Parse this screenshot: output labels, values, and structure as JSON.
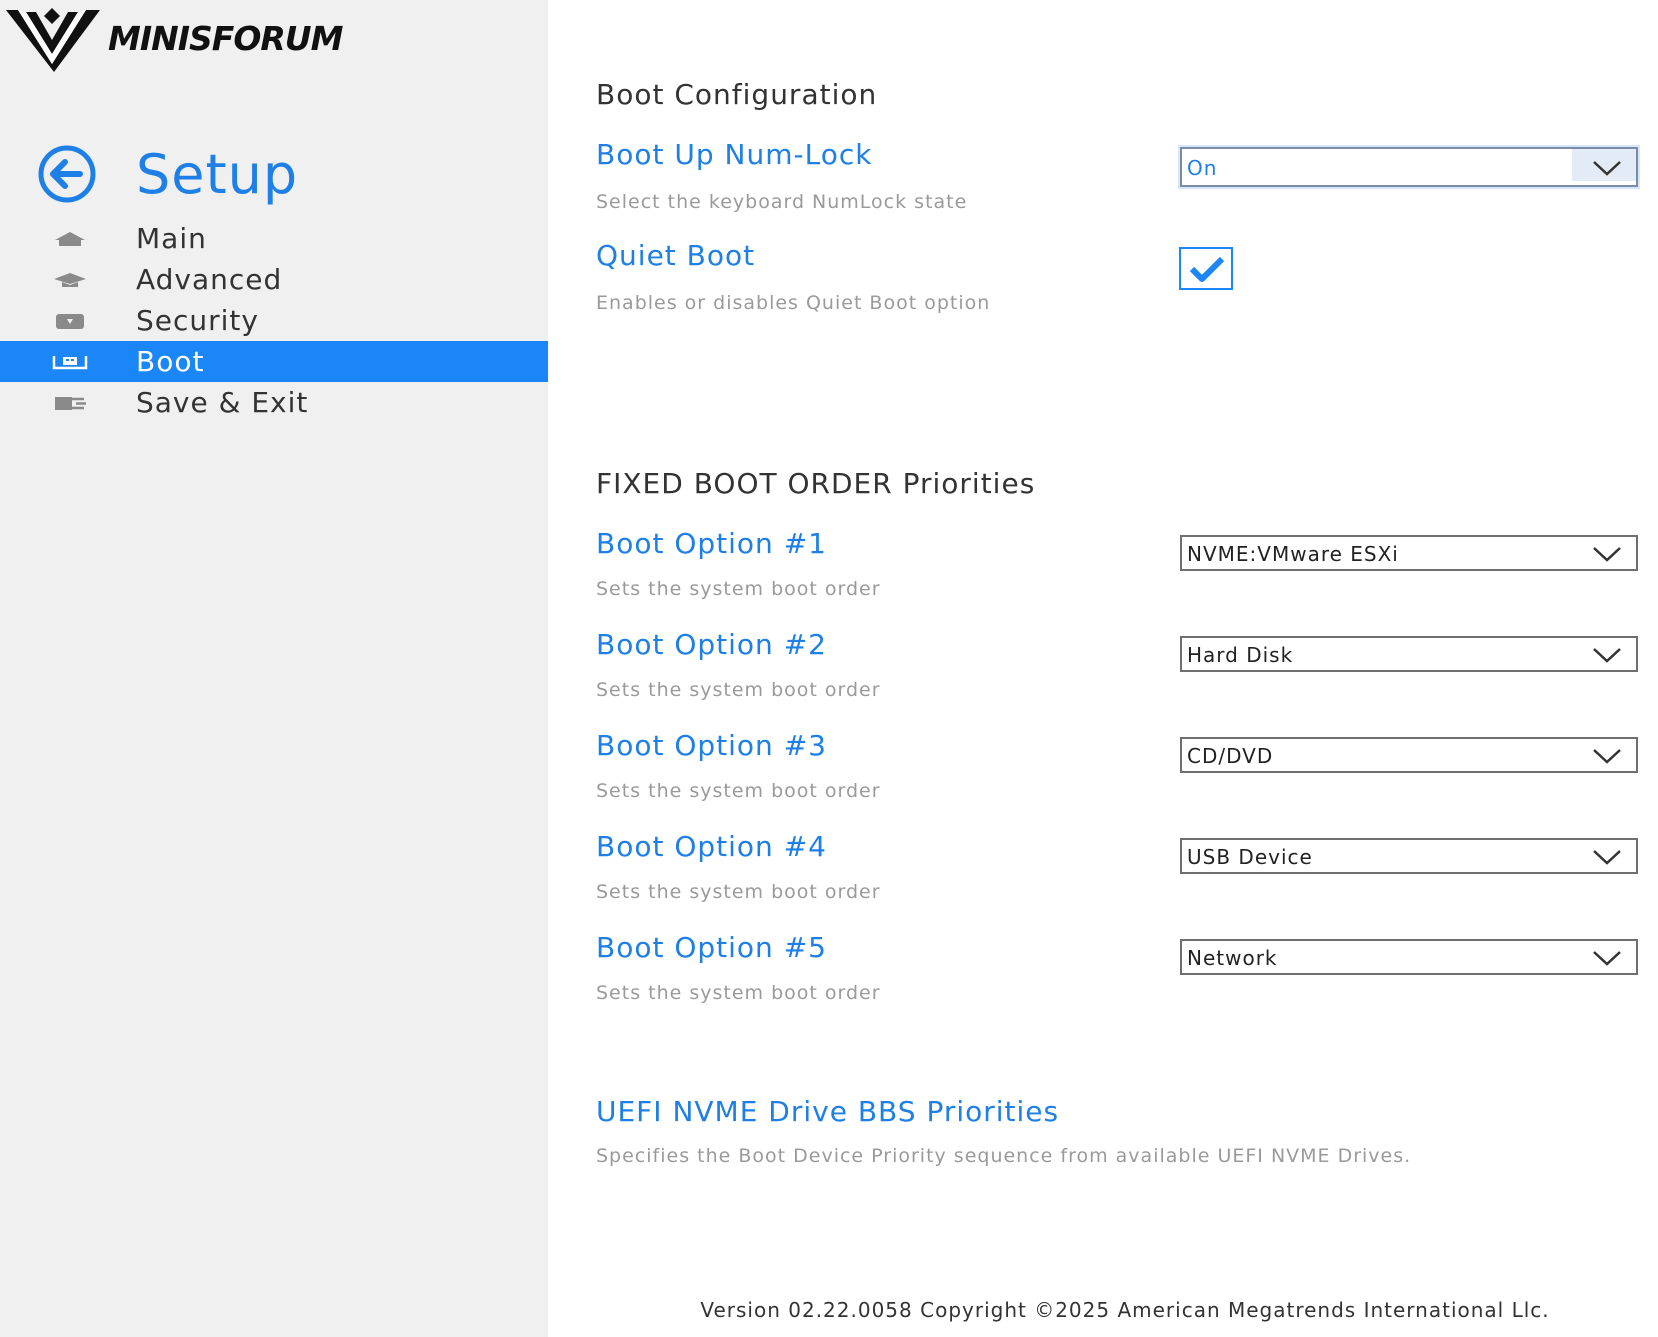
{
  "brand": {
    "logo_text": "MINISFORUM"
  },
  "sidebar": {
    "title": "Setup",
    "items": [
      {
        "label": "Main",
        "icon": "home-icon",
        "active": false
      },
      {
        "label": "Advanced",
        "icon": "graduation-cap-icon",
        "active": false
      },
      {
        "label": "Security",
        "icon": "shield-icon",
        "active": false
      },
      {
        "label": "Boot",
        "icon": "boot-drive-icon",
        "active": true
      },
      {
        "label": "Save & Exit",
        "icon": "exit-icon",
        "active": false
      }
    ]
  },
  "boot_config": {
    "title": "Boot Configuration",
    "numlock": {
      "label": "Boot Up Num-Lock",
      "description": "Select the keyboard NumLock state",
      "value": "On"
    },
    "quiet_boot": {
      "label": "Quiet Boot",
      "description": "Enables or disables Quiet Boot option",
      "checked": true
    }
  },
  "boot_order": {
    "title": "FIXED BOOT ORDER Priorities",
    "options": [
      {
        "label": "Boot Option #1",
        "description": "Sets the system boot order",
        "value": "NVME:VMware ESXi"
      },
      {
        "label": "Boot Option #2",
        "description": "Sets the system boot order",
        "value": "Hard Disk"
      },
      {
        "label": "Boot Option #3",
        "description": "Sets the system boot order",
        "value": "CD/DVD"
      },
      {
        "label": "Boot Option #4",
        "description": "Sets the system boot order",
        "value": "USB Device"
      },
      {
        "label": "Boot Option #5",
        "description": "Sets the system boot order",
        "value": "Network"
      }
    ]
  },
  "nvme_priorities": {
    "label": "UEFI NVME Drive BBS Priorities",
    "description": "Specifies the Boot Device Priority sequence from available UEFI NVME Drives."
  },
  "footer": {
    "text": "Version 02.22.0058 Copyright ©2025 American Megatrends International Llc."
  },
  "colors": {
    "accent": "#1e7fe6",
    "active_nav": "#1a86f7",
    "sidebar_bg": "#f0f0f0"
  }
}
